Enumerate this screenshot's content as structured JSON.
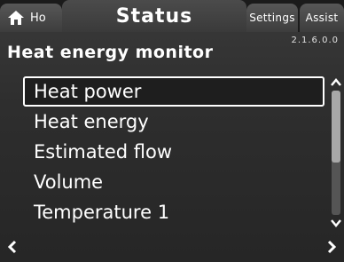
{
  "tabs": {
    "home_label": "Ho",
    "status_label": "Status",
    "settings_label": "Settings",
    "assist_label": "Assist"
  },
  "version": "2.1.6.0.0",
  "page_title": "Heat energy monitor",
  "menu": {
    "items": [
      {
        "label": "Heat power",
        "selected": true
      },
      {
        "label": "Heat energy",
        "selected": false
      },
      {
        "label": "Estimated flow",
        "selected": false
      },
      {
        "label": "Volume",
        "selected": false
      },
      {
        "label": "Temperature 1",
        "selected": false
      }
    ]
  },
  "scroll": {
    "position_fraction": 0.0,
    "visible_fraction": 0.58
  },
  "icons": {
    "home": "home-icon",
    "up": "chevron-up-icon",
    "down": "chevron-down-icon",
    "back": "chevron-left-icon",
    "forward": "chevron-right-icon"
  }
}
